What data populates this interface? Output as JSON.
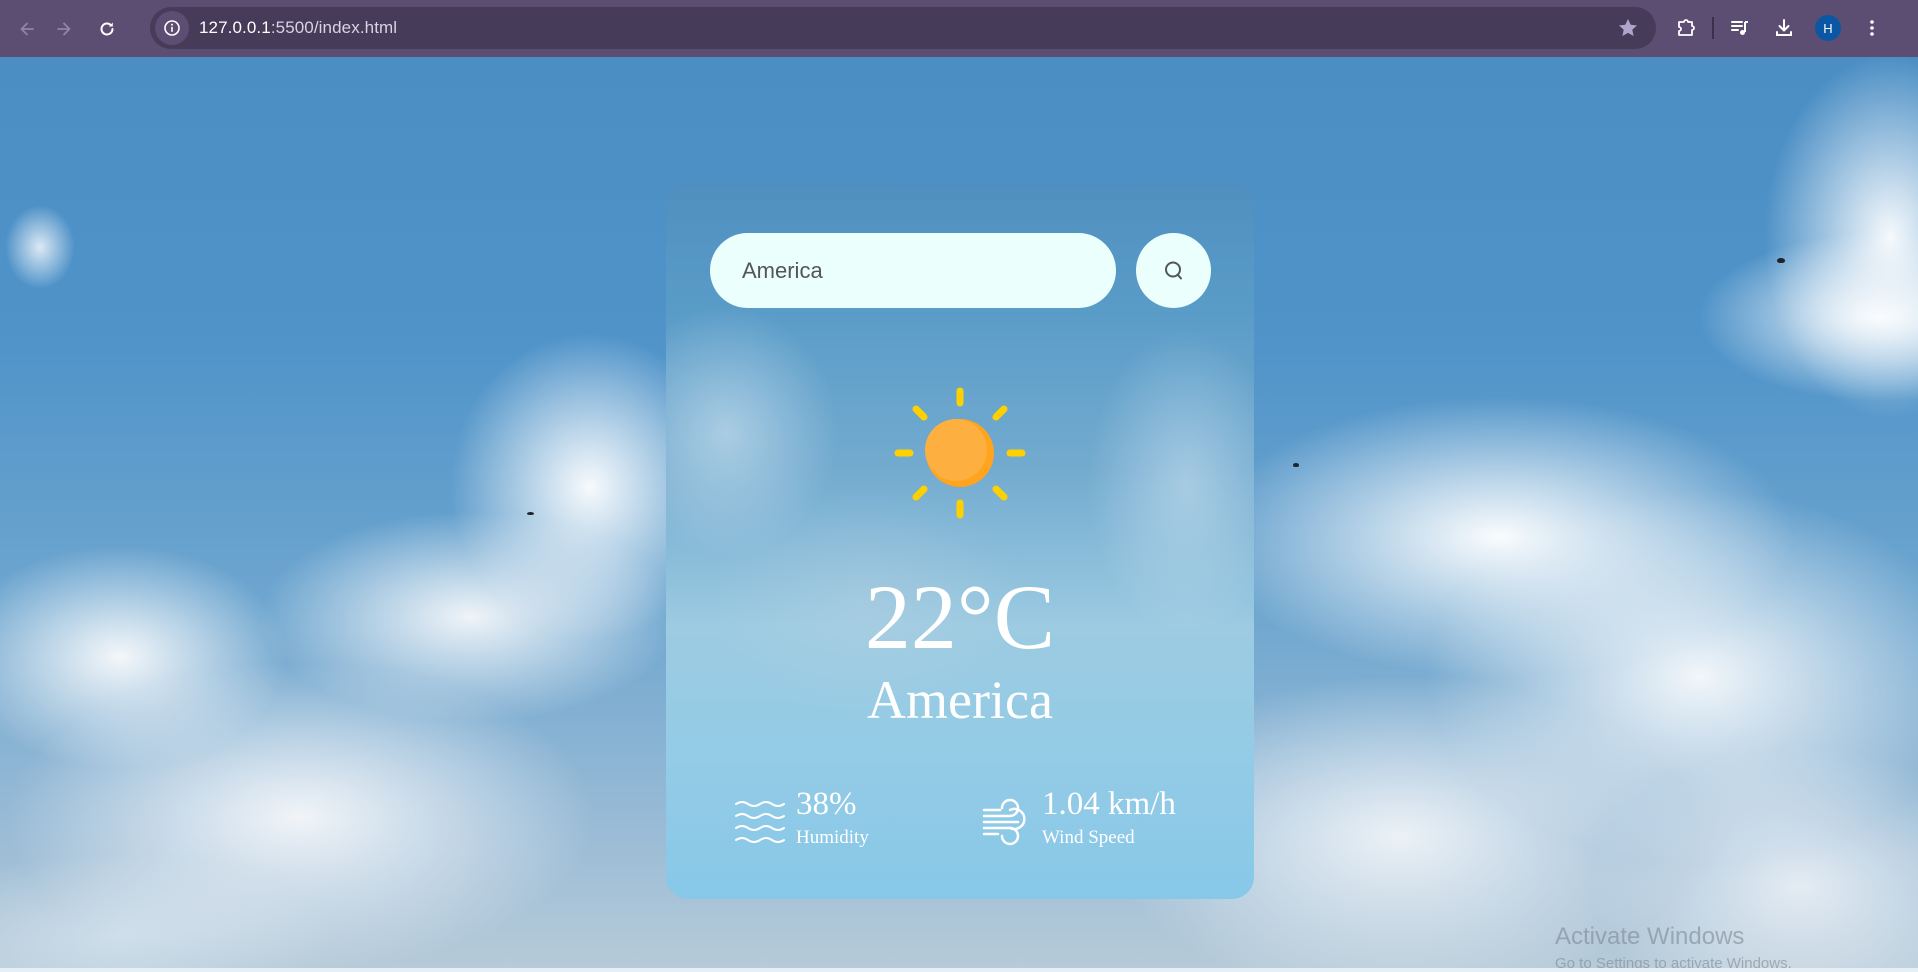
{
  "browser": {
    "url_host": "127.0.0.1",
    "url_rest": ":5500/index.html",
    "profile_initial": "H",
    "icons": {
      "back": "arrow-left-icon",
      "forward": "arrow-right-icon",
      "reload": "reload-icon",
      "site_info": "info-icon",
      "bookmark": "star-icon",
      "extensions": "puzzle-icon",
      "media": "playlist-music-icon",
      "downloads": "download-icon",
      "menu": "kebab-menu-icon"
    }
  },
  "weather": {
    "search": {
      "value": "America",
      "button_icon": "search-icon"
    },
    "condition_icon": "sun-icon",
    "temperature": "22°C",
    "city": "America",
    "humidity": {
      "value": "38%",
      "label": "Humidity",
      "icon": "humidity-waves-icon"
    },
    "wind": {
      "value": "1.04 km/h",
      "label": "Wind Speed",
      "icon": "wind-icon"
    },
    "colors": {
      "input_bg": "#ebfffc",
      "sun_body": "#fdb040",
      "sun_rays": "#ffd000",
      "text": "#ffffff"
    }
  },
  "os_watermark": {
    "title": "Activate Windows",
    "subtitle": "Go to Settings to activate Windows."
  }
}
